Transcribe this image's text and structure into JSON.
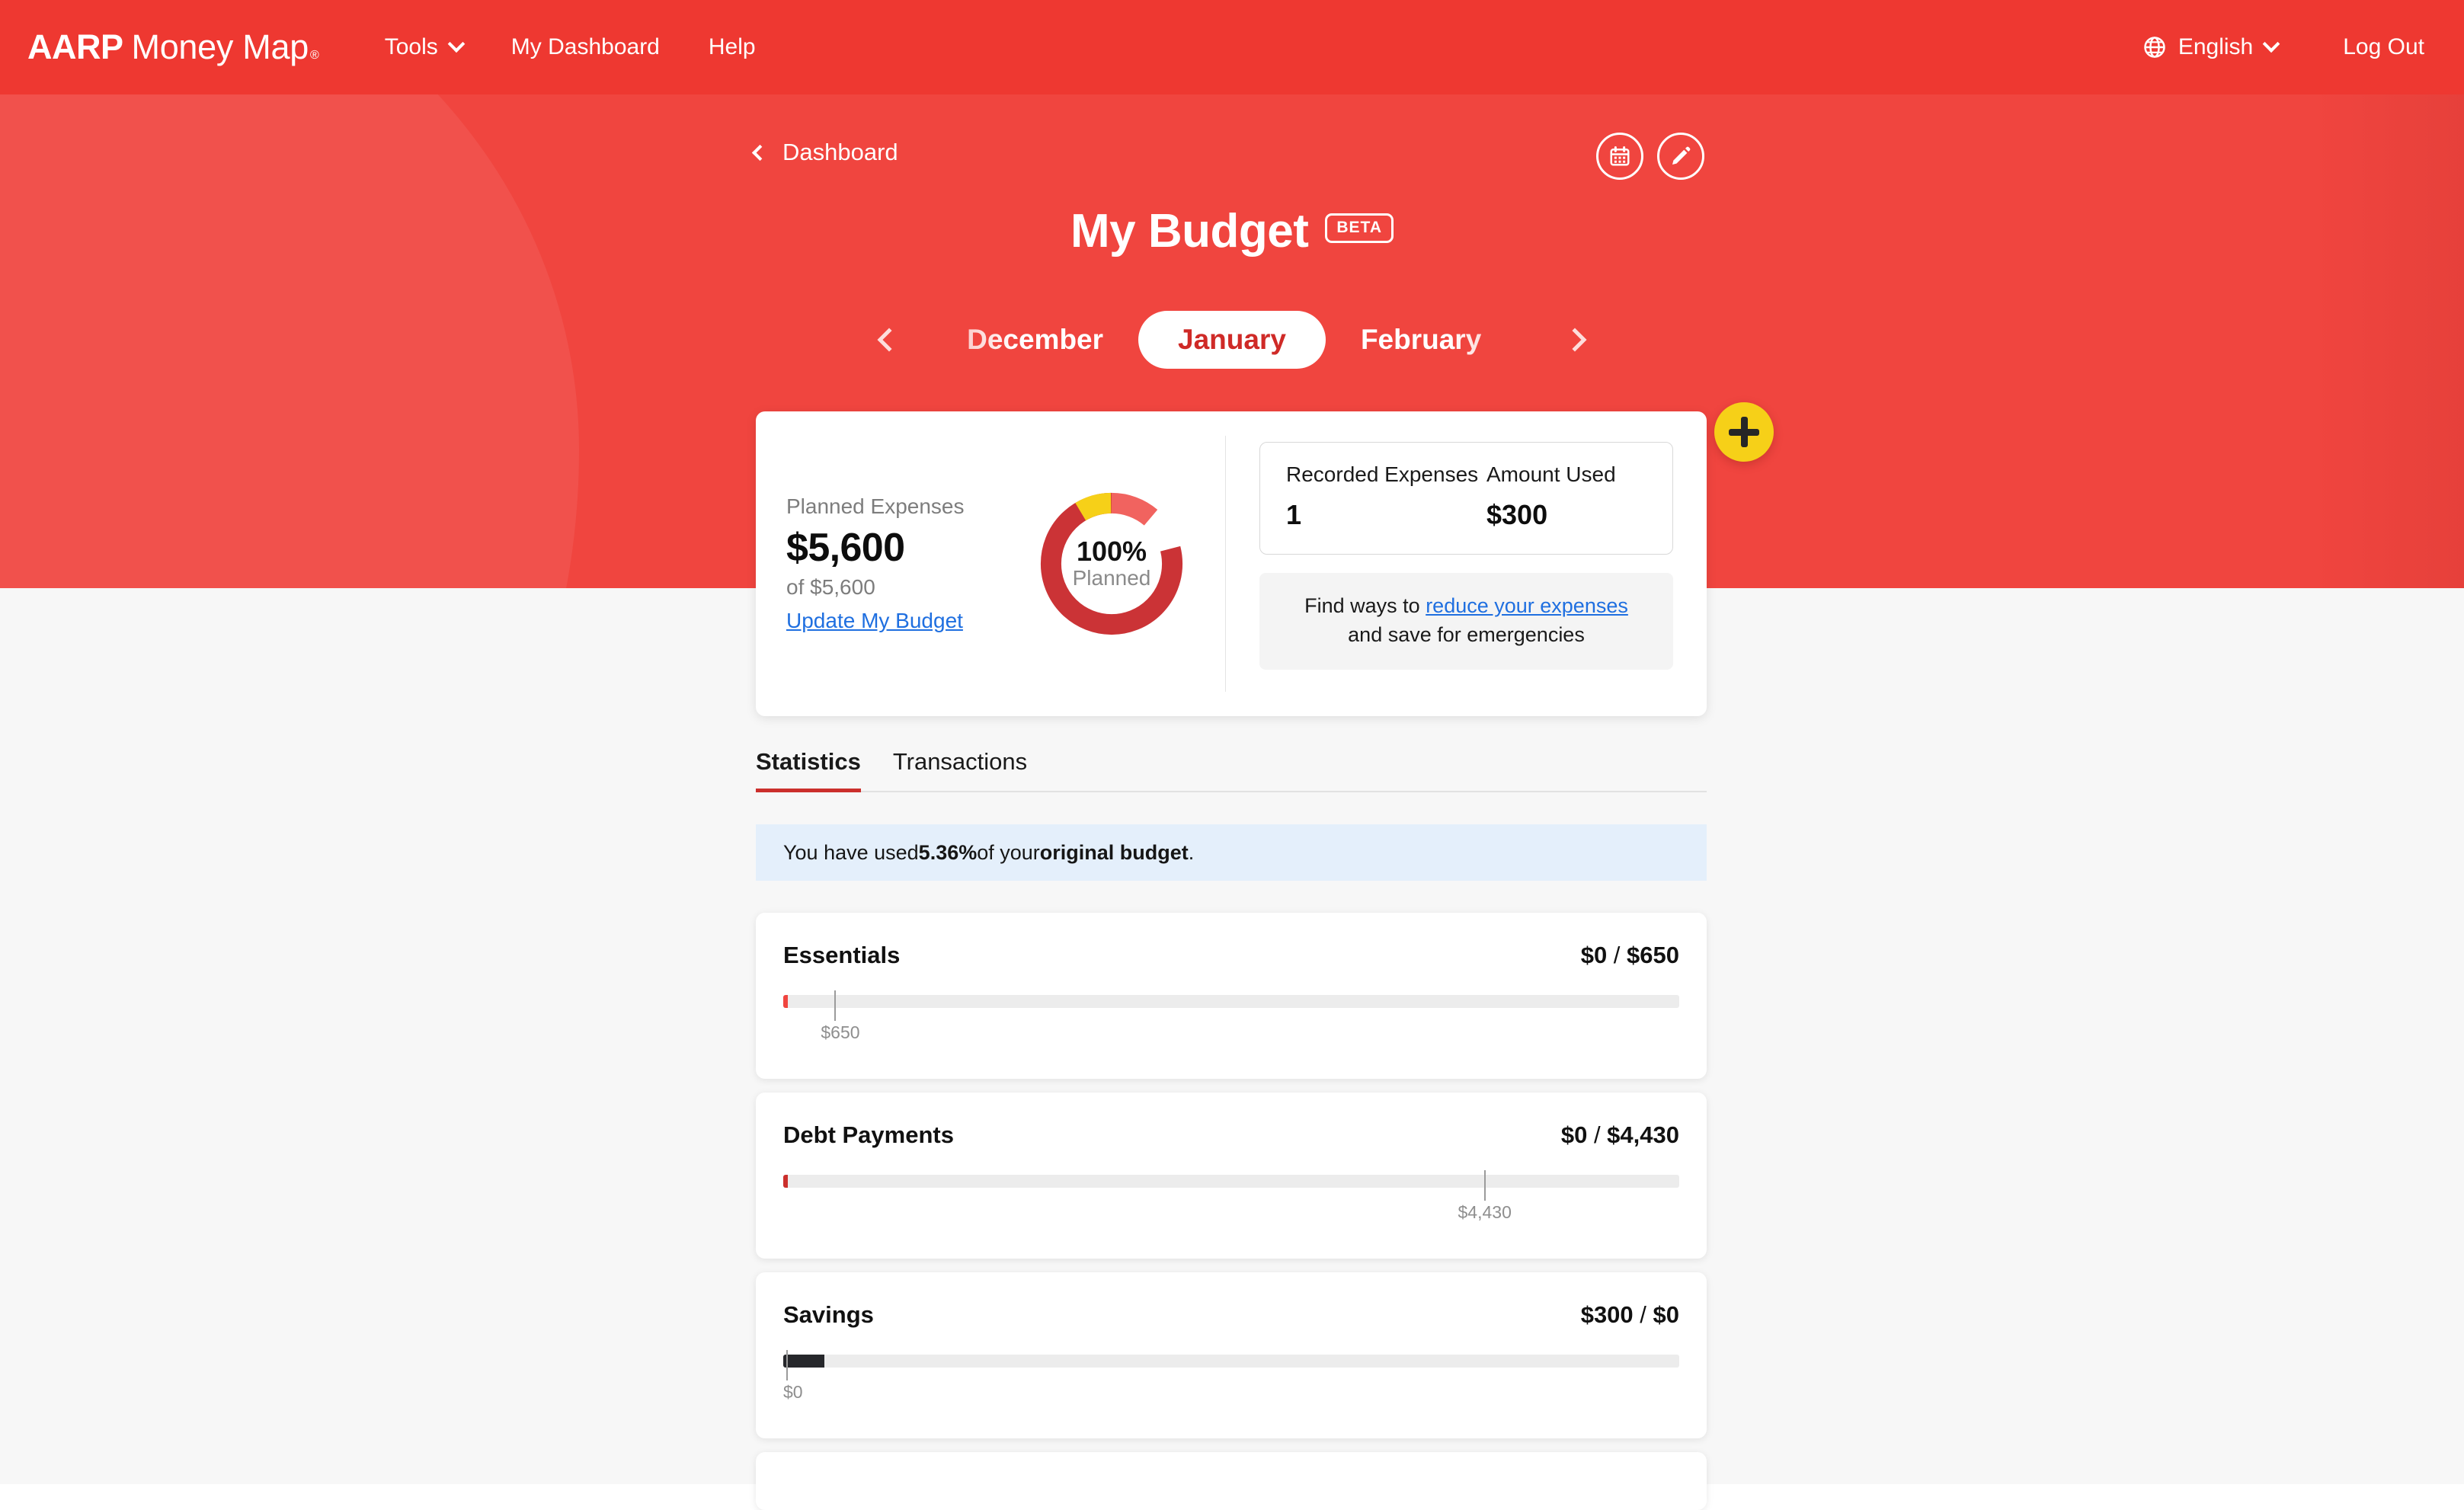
{
  "navbar": {
    "brand_bold": "AARP",
    "brand_rest": "Money Map",
    "brand_tm": "®",
    "links": [
      {
        "label": "Tools",
        "has_caret": true,
        "icon": "chevron-down-icon"
      },
      {
        "label": "My Dashboard",
        "has_caret": false
      },
      {
        "label": "Help",
        "has_caret": false
      }
    ],
    "language": {
      "label": "English",
      "icon": "globe-icon"
    },
    "logout_label": "Log Out",
    "bg_color": "#ee3831"
  },
  "hero": {
    "bg_color": "#f0453f",
    "breadcrumb": {
      "label": "Dashboard",
      "icon": "chevron-left-icon"
    },
    "actions": [
      {
        "name": "calendar-icon",
        "title": "Calendar"
      },
      {
        "name": "pencil-icon",
        "title": "Edit"
      }
    ],
    "title": "My Budget",
    "badge": "BETA"
  },
  "month_nav": {
    "prev_month": "December",
    "current_month": "January",
    "next_month": "February",
    "prev_arrow_icon": "chevron-left-icon",
    "next_arrow_icon": "chevron-right-icon"
  },
  "summary": {
    "planned_label": "Planned Expenses",
    "planned_amount": "$5,600",
    "planned_of": "of $5,600",
    "update_link": "Update My Budget",
    "donut": {
      "percent_text": "100%",
      "percent_sub": "Planned",
      "segments": [
        {
          "name": "spent",
          "color": "#cb3336",
          "fraction": 0.79
        },
        {
          "name": "remaining",
          "color": "#f1635f",
          "fraction": 0.12
        },
        {
          "name": "savings",
          "color": "#f6d018",
          "fraction": 0.09
        }
      ]
    },
    "stats": [
      {
        "header": "Recorded Expenses",
        "value": "1"
      },
      {
        "header": "Amount Used",
        "value": "$300"
      }
    ],
    "tip_prefix": "Find ways to ",
    "tip_link": "reduce your expenses",
    "tip_suffix": "and save for emergencies"
  },
  "fab": {
    "icon": "plus-icon",
    "color": "#f6d018"
  },
  "tabs": [
    {
      "label": "Statistics",
      "active": true
    },
    {
      "label": "Transactions",
      "active": false
    }
  ],
  "info_banner": {
    "prefix": "You have used ",
    "percent": "5.36%",
    "middle": " of your ",
    "bold_tail": "original budget",
    "suffix": "."
  },
  "categories": [
    {
      "name": "Essentials",
      "spent": "$0",
      "separator": " / ",
      "total": "$650",
      "bar": {
        "fill_percent": 0.5,
        "fill_color": "#f0453f",
        "tick_percent": 5.7,
        "tick_label": "$650"
      }
    },
    {
      "name": "Debt Payments",
      "spent": "$0",
      "separator": " / ",
      "total": "$4,430",
      "bar": {
        "fill_percent": 0.5,
        "fill_color": "#cb2f2c",
        "tick_percent": 78.2,
        "tick_label": "$4,430"
      }
    },
    {
      "name": "Savings",
      "spent": "$300",
      "separator": " / ",
      "total": "$0",
      "bar": {
        "fill_percent": 4.6,
        "fill_color": "#26272b",
        "tick_percent": 0.3,
        "tick_label": "$0"
      }
    }
  ]
}
